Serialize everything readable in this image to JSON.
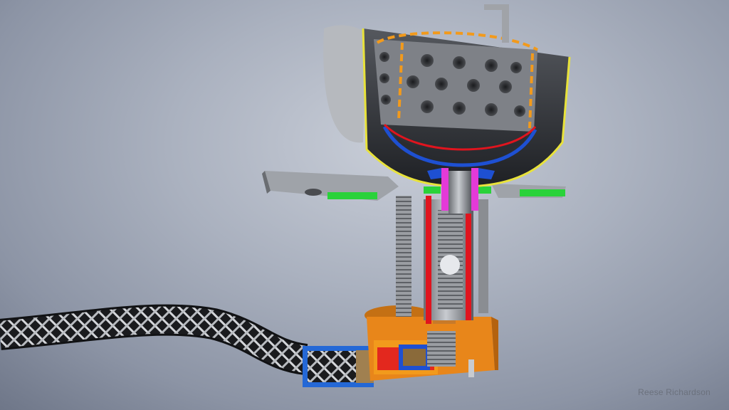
{
  "credit": {
    "text": "Reese Richardson"
  },
  "colors": {
    "background_center": "#c9ced8",
    "background_edge": "#6e7688",
    "steel": "#8a8d92",
    "steel_dark": "#3a3c40",
    "outline_yellow": "#e8e23a",
    "section_orange": "#f29a1c",
    "section_red": "#e0141e",
    "section_blue": "#1e50d2",
    "section_magenta": "#e43ad8",
    "section_green": "#2ad23a",
    "fitting_orange": "#e8861a"
  },
  "icons": {
    "burner": "burner-cup-icon",
    "hose": "braided-hose-icon",
    "fitting": "elbow-fitting-icon"
  }
}
